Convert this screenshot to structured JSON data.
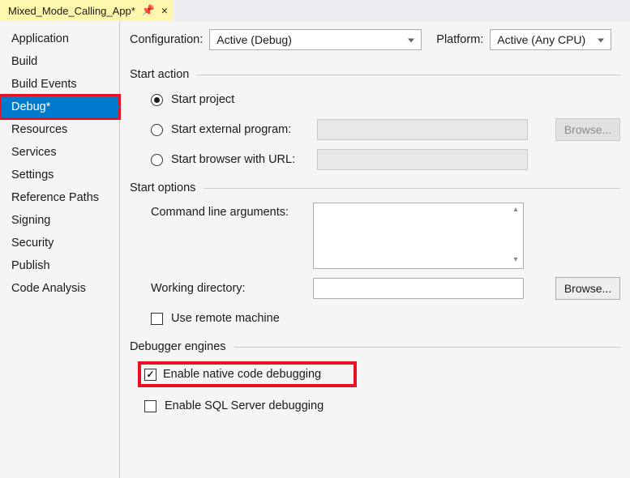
{
  "tab": {
    "title": "Mixed_Mode_Calling_App*",
    "pin_glyph": "📌",
    "close_glyph": "✕"
  },
  "sidebar": {
    "items": [
      {
        "label": "Application"
      },
      {
        "label": "Build"
      },
      {
        "label": "Build Events"
      },
      {
        "label": "Debug*",
        "selected": true,
        "highlighted": true
      },
      {
        "label": "Resources"
      },
      {
        "label": "Services"
      },
      {
        "label": "Settings"
      },
      {
        "label": "Reference Paths"
      },
      {
        "label": "Signing"
      },
      {
        "label": "Security"
      },
      {
        "label": "Publish"
      },
      {
        "label": "Code Analysis"
      }
    ]
  },
  "toprow": {
    "config_label": "Configuration:",
    "config_value": "Active (Debug)",
    "platform_label": "Platform:",
    "platform_value": "Active (Any CPU)"
  },
  "sections": {
    "start_action": {
      "title": "Start action",
      "opt_project": "Start project",
      "opt_external": "Start external program:",
      "opt_browser": "Start browser with URL:",
      "browse": "Browse..."
    },
    "start_options": {
      "title": "Start options",
      "cmdline_label": "Command line arguments:",
      "workdir_label": "Working directory:",
      "browse": "Browse...",
      "remote": "Use remote machine"
    },
    "debugger": {
      "title": "Debugger engines",
      "native": "Enable native code debugging",
      "sql": "Enable SQL Server debugging"
    }
  }
}
